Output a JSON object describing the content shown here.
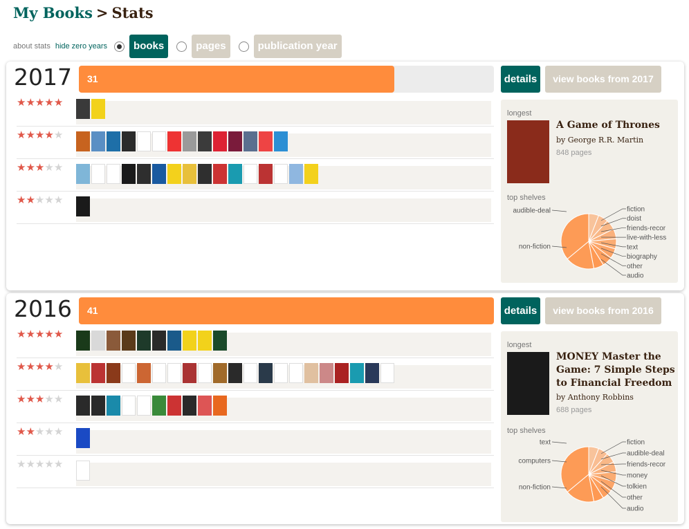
{
  "breadcrumb": {
    "root": "My Books",
    "separator": ">",
    "current": "Stats"
  },
  "controls": {
    "about_label": "about stats",
    "hide_zero_label": "hide zero years",
    "options": [
      {
        "label": "books",
        "selected": true
      },
      {
        "label": "pages",
        "selected": false
      },
      {
        "label": "publication year",
        "selected": false
      }
    ]
  },
  "colors": {
    "accent": "#00635d",
    "bar": "#ff8c3c",
    "star": "#e0584a",
    "pie": "#ff8c3c"
  },
  "years": [
    {
      "year": "2017",
      "count": "31",
      "bar_fraction": 0.76,
      "details_label": "details",
      "view_label": "view books from 2017",
      "ratings": [
        {
          "stars": 5,
          "covers": [
            "#3a3a3a",
            "#f2d21b"
          ]
        },
        {
          "stars": 4,
          "covers": [
            "#c7631f",
            "#5a8fc4",
            "#1e6fa8",
            "#2b2b2b",
            "#ffffff",
            "#ffffff",
            "#e33",
            "#9a9a9a",
            "#3b3b3b",
            "#d23",
            "#7a1b3b",
            "#5a6f8f",
            "#e44",
            "#2c8fd4"
          ]
        },
        {
          "stars": 3,
          "covers": [
            "#7fb6d8",
            "#ffffff",
            "#ffffff",
            "#1a1a1a",
            "#2e2e2e",
            "#1a5aa0",
            "#f3d11c",
            "#e8c03b",
            "#2f2f2f",
            "#c33",
            "#1a9bb0",
            "#ffffff",
            "#b33",
            "#ffffff",
            "#8fb7e0",
            "#f3d11c"
          ]
        },
        {
          "stars": 2,
          "covers": [
            "#1a1a1a"
          ]
        }
      ],
      "longest": {
        "label": "longest",
        "title": "A Game of Thrones",
        "author": "by George R.R. Martin",
        "pages": "848 pages",
        "cover_color": "#8a2b1b"
      },
      "shelves": {
        "label": "top shelves",
        "left": [
          "audible-deal",
          "non-fiction"
        ],
        "right": [
          "fiction",
          "doist",
          "friends-recor",
          "live-with-less",
          "text",
          "biography",
          "other",
          "audio"
        ]
      }
    },
    {
      "year": "2016",
      "count": "41",
      "bar_fraction": 1,
      "details_label": "details",
      "view_label": "view books from 2016",
      "ratings": [
        {
          "stars": 5,
          "covers": [
            "#1a3a1a",
            "#d9d9d9",
            "#8a5a3a",
            "#5a3a1a",
            "#1e3a2a",
            "#2a2a2a",
            "#1a5a8a",
            "#f2d21b",
            "#f2d21b",
            "#1a4a2a"
          ]
        },
        {
          "stars": 4,
          "covers": [
            "#e8c03b",
            "#b33",
            "#8a3a1a",
            "#ffffff",
            "#c63",
            "#ffffff",
            "#ffffff",
            "#a33",
            "#ffffff",
            "#a06a2a",
            "#2a2a2a",
            "#ffffff",
            "#2a3a4a",
            "#ffffff",
            "#ffffff",
            "#e0c0a0",
            "#c88",
            "#a22",
            "#1a9bb0",
            "#2a3a5a",
            "#ffffff"
          ]
        },
        {
          "stars": 3,
          "covers": [
            "#2a2a2a",
            "#2a2a2a",
            "#1a8aaa",
            "#ffffff",
            "#ffffff",
            "#3a8a3a",
            "#c33",
            "#2a2a2a",
            "#d55",
            "#e8681f"
          ]
        },
        {
          "stars": 2,
          "covers": [
            "#1a4ac4"
          ]
        },
        {
          "stars": 0,
          "covers": [
            "#ffffff"
          ]
        }
      ],
      "longest": {
        "label": "longest",
        "title": "MONEY Master the Game: 7 Simple Steps to Financial Freedom",
        "author": "by Anthony Robbins",
        "pages": "688 pages",
        "cover_color": "#1a1a1a"
      },
      "shelves": {
        "label": "top shelves",
        "left": [
          "text",
          "computers",
          "non-fiction"
        ],
        "right": [
          "fiction",
          "audible-deal",
          "friends-recor",
          "money",
          "tolkien",
          "other",
          "audio"
        ]
      }
    }
  ]
}
